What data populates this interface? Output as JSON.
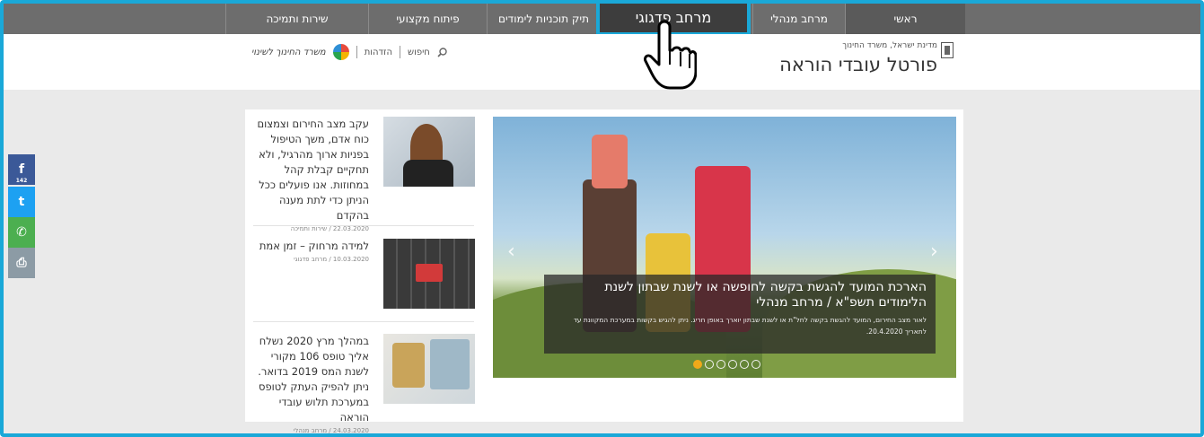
{
  "nav": {
    "items": [
      {
        "label": "ראשי"
      },
      {
        "label": "מרחב מנהלי"
      },
      {
        "label": "מרחב פדגוגי"
      },
      {
        "label": "תיק תוכניות לימודים"
      },
      {
        "label": "פיתוח מקצועי"
      },
      {
        "label": "שירות ותמיכה"
      }
    ],
    "active_label": "מרחב פדגוגי"
  },
  "header": {
    "ministry_small": "מדינת ישראל, משרד החינוך",
    "portal_title": "פורטל עובדי הוראה",
    "search_label": "חיפוש",
    "login_label": "הזדהות",
    "logo_text": "משרד החינוך לשינוי"
  },
  "slider": {
    "caption_title": "הארכת המועד להגשת בקשה לחופשה או לשנת שבתון לשנת הלימודים תשפ\"א / מרחב מנהלי",
    "caption_text": "לאור מצב החירום, המועד להגשת בקשה לחל\"ת או לשנת שבתון יוארך באופן חריג. ניתן להגיש בקשות במערכת המקוונת עד לתאריך 20.4.2020.",
    "prev_arrow": "‹",
    "next_arrow": "›",
    "slide_count": 6,
    "active_slide": 1
  },
  "news": [
    {
      "title": "עקב מצב החירום וצמצום כוח אדם, משך הטיפול בפניות ארוך מהרגיל, ולא תחקיים קבלת קהל במחוזות. אנו פועלים ככל הניתן כדי לתת מענה בהקדם",
      "meta": "22.03.2020 / שירות ותמיכה"
    },
    {
      "title": "למידה מרחוק – זמן אמת",
      "meta": "10.03.2020 / מרחב פדגוגי"
    },
    {
      "title": "במהלך מרץ 2020 נשלח אליך טופס 106 מקורי לשנת המס 2019 בדואר. ניתן להפיק העתק לטופס במערכת תלוש עובדי הוראה",
      "meta": "24.03.2020 / מרחב מנהלי"
    }
  ],
  "social": {
    "facebook_count": "142",
    "facebook_glyph": "f",
    "twitter_glyph": "t",
    "whatsapp_glyph": "✆",
    "print_glyph": "⎙"
  },
  "colors": {
    "accent": "#1aa8d8",
    "nav_bg": "#6d6d6d",
    "facebook": "#3b5998",
    "twitter": "#1da1f2",
    "whatsapp": "#4caf50",
    "print": "#8c9ba5"
  }
}
